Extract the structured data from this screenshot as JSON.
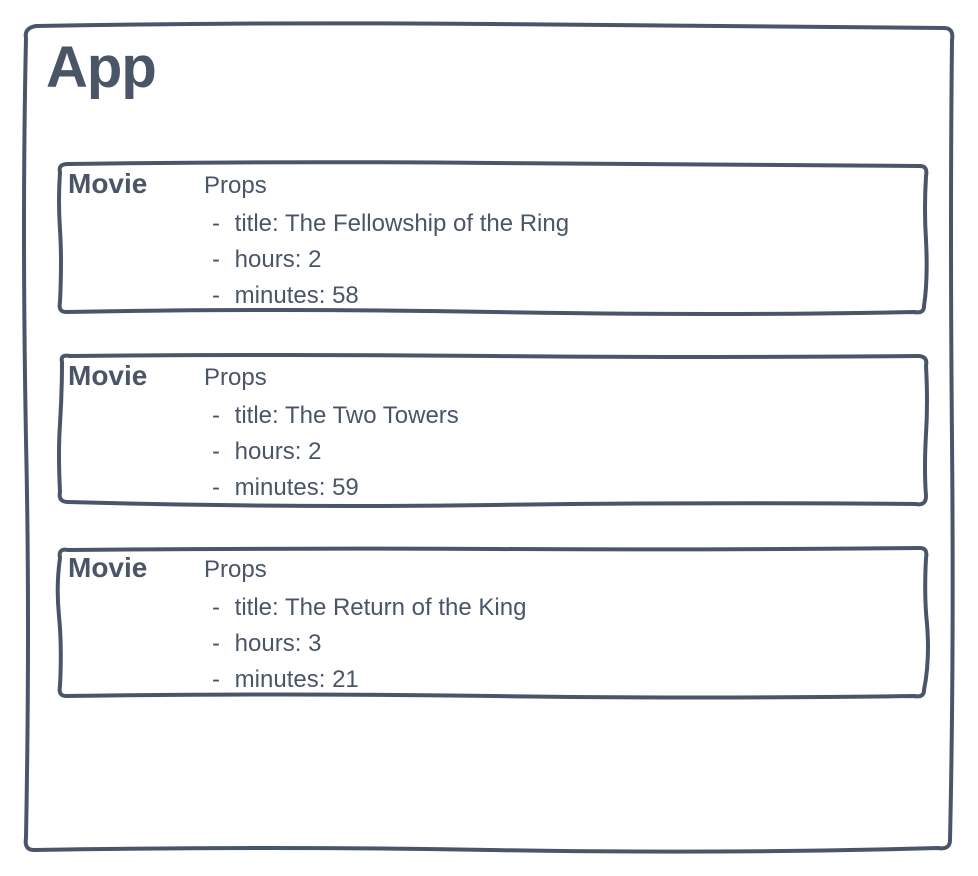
{
  "app": {
    "title": "App"
  },
  "labels": {
    "component": "Movie",
    "propsHeading": "Props",
    "propTitle": "title",
    "propHours": "hours",
    "propMinutes": "minutes"
  },
  "movies": [
    {
      "title": "The Fellowship of the Ring",
      "hours": 2,
      "minutes": 58
    },
    {
      "title": "The Two Towers",
      "hours": 2,
      "minutes": 59
    },
    {
      "title": "The Return of the King",
      "hours": 3,
      "minutes": 21
    }
  ]
}
